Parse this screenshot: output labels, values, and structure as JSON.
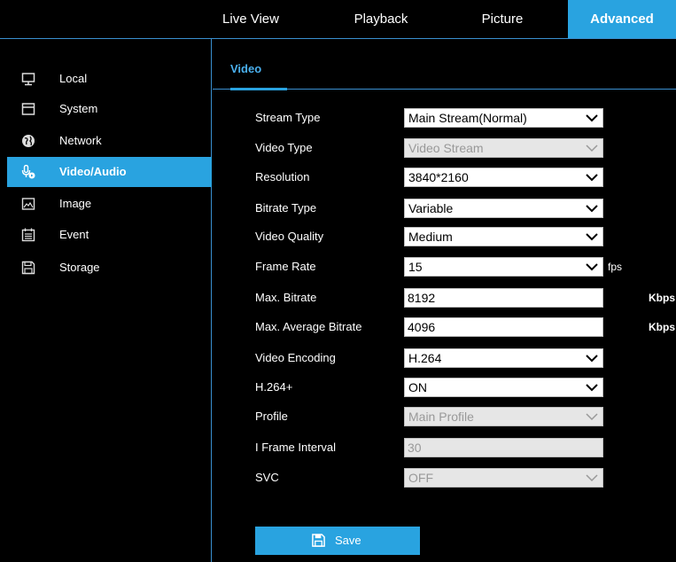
{
  "topnav": {
    "tabs": [
      {
        "label": "Live View"
      },
      {
        "label": "Playback"
      },
      {
        "label": "Picture"
      },
      {
        "label": "Advanced"
      }
    ],
    "active_color": "#29a3e0"
  },
  "sidebar": {
    "items": [
      {
        "label": "Local",
        "icon": "monitor-icon"
      },
      {
        "label": "System",
        "icon": "system-icon"
      },
      {
        "label": "Network",
        "icon": "globe-icon"
      },
      {
        "label": "Video/Audio",
        "icon": "microphone-icon"
      },
      {
        "label": "Image",
        "icon": "image-icon"
      },
      {
        "label": "Event",
        "icon": "calendar-icon"
      },
      {
        "label": "Storage",
        "icon": "floppy-icon"
      }
    ],
    "active": "Video/Audio"
  },
  "main": {
    "subtab": "Video",
    "fields": {
      "stream_type": {
        "label": "Stream Type",
        "value": "Main Stream(Normal)"
      },
      "video_type": {
        "label": "Video Type",
        "value": "Video Stream"
      },
      "resolution": {
        "label": "Resolution",
        "value": "3840*2160"
      },
      "bitrate_type": {
        "label": "Bitrate Type",
        "value": "Variable"
      },
      "video_quality": {
        "label": "Video Quality",
        "value": "Medium"
      },
      "frame_rate": {
        "label": "Frame Rate",
        "value": "15",
        "unit": "fps"
      },
      "max_bitrate": {
        "label": "Max. Bitrate",
        "value": "8192",
        "unit": "Kbps"
      },
      "max_avg_bitrate": {
        "label": "Max. Average Bitrate",
        "value": "4096",
        "unit": "Kbps"
      },
      "video_encoding": {
        "label": "Video Encoding",
        "value": "H.264"
      },
      "h264plus": {
        "label": "H.264+",
        "value": "ON"
      },
      "profile": {
        "label": "Profile",
        "value": "Main Profile"
      },
      "i_frame_interval": {
        "label": "I Frame Interval",
        "value": "30"
      },
      "svc": {
        "label": "SVC",
        "value": "OFF"
      }
    },
    "save_label": "Save"
  }
}
